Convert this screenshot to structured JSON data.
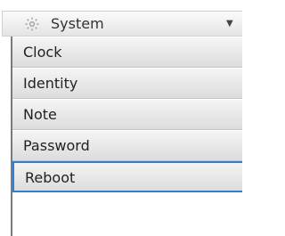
{
  "menu": {
    "header": {
      "label": "System",
      "icon": "gear-icon",
      "toggle_icon": "chevron-down-icon"
    },
    "items": [
      {
        "label": "Clock"
      },
      {
        "label": "Identity"
      },
      {
        "label": "Note"
      },
      {
        "label": "Password"
      },
      {
        "label": "Reboot",
        "selected": true
      }
    ]
  },
  "colors": {
    "selected_border": "#2f7fd6",
    "icon_gray": "#a6a6a6"
  }
}
